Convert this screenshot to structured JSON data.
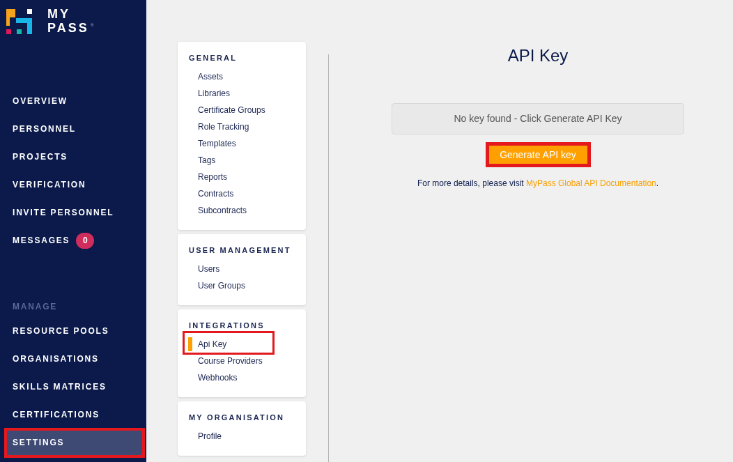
{
  "sidebar": {
    "logo": {
      "lines": [
        "MY",
        "PASS"
      ],
      "mark": "®"
    },
    "sections": [
      {
        "items": [
          {
            "label": "OVERVIEW",
            "selected": false,
            "highlighted": false
          },
          {
            "label": "PERSONNEL",
            "selected": false,
            "highlighted": false
          },
          {
            "label": "PROJECTS",
            "selected": false,
            "highlighted": false
          },
          {
            "label": "VERIFICATION",
            "selected": false,
            "highlighted": false
          },
          {
            "label": "INVITE PERSONNEL",
            "selected": false,
            "highlighted": false
          },
          {
            "label": "MESSAGES",
            "badge": "0",
            "selected": false,
            "highlighted": false
          }
        ]
      },
      {
        "label": "MANAGE",
        "items": [
          {
            "label": "RESOURCE POOLS",
            "selected": false,
            "highlighted": false
          },
          {
            "label": "ORGANISATIONS",
            "selected": false,
            "highlighted": false
          },
          {
            "label": "SKILLS MATRICES",
            "selected": false,
            "highlighted": false
          },
          {
            "label": "CERTIFICATIONS",
            "selected": false,
            "highlighted": false
          },
          {
            "label": "SETTINGS",
            "selected": true,
            "highlighted": true
          }
        ]
      }
    ]
  },
  "settings_menu": {
    "groups": [
      {
        "title": "GENERAL",
        "items": [
          {
            "label": "Assets",
            "selected": false,
            "highlighted": false
          },
          {
            "label": "Libraries",
            "selected": false,
            "highlighted": false
          },
          {
            "label": "Certificate Groups",
            "selected": false,
            "highlighted": false
          },
          {
            "label": "Role Tracking",
            "selected": false,
            "highlighted": false
          },
          {
            "label": "Templates",
            "selected": false,
            "highlighted": false
          },
          {
            "label": "Tags",
            "selected": false,
            "highlighted": false
          },
          {
            "label": "Reports",
            "selected": false,
            "highlighted": false
          },
          {
            "label": "Contracts",
            "selected": false,
            "highlighted": false
          },
          {
            "label": "Subcontracts",
            "selected": false,
            "highlighted": false
          }
        ]
      },
      {
        "title": "USER MANAGEMENT",
        "items": [
          {
            "label": "Users",
            "selected": false,
            "highlighted": false
          },
          {
            "label": "User Groups",
            "selected": false,
            "highlighted": false
          }
        ]
      },
      {
        "title": "INTEGRATIONS",
        "items": [
          {
            "label": "Api Key",
            "selected": true,
            "highlighted": true
          },
          {
            "label": "Course Providers",
            "selected": false,
            "highlighted": false
          },
          {
            "label": "Webhooks",
            "selected": false,
            "highlighted": false
          }
        ]
      },
      {
        "title": "MY ORGANISATION",
        "items": [
          {
            "label": "Profile",
            "selected": false,
            "highlighted": false
          }
        ]
      }
    ]
  },
  "content": {
    "title": "API Key",
    "key_display": {
      "value": "No key found - Click Generate API Key"
    },
    "generate_button": {
      "label": "Generate API key",
      "highlighted": true
    },
    "details": {
      "prefix": "For more details, please visit",
      "link": "MyPass Global API Documentation",
      "suffix": "."
    }
  }
}
